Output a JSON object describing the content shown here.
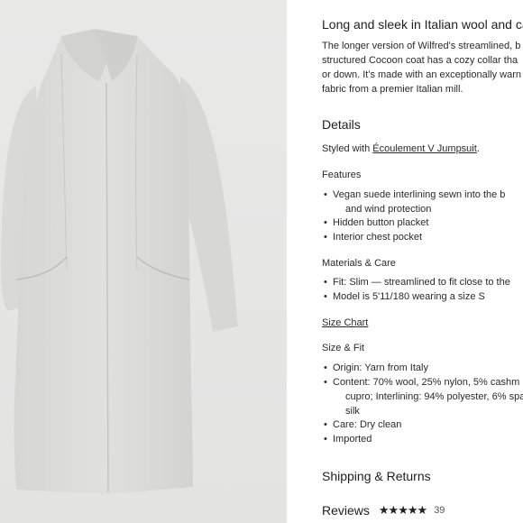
{
  "product": {
    "headline": "Long and sleek in Italian wool and ca",
    "description": [
      "The longer version of Wilfred's streamlined, b",
      "structured Cocoon coat has a cozy collar tha",
      "or down. It's made with an exceptionally warn",
      "fabric from a premier Italian mill."
    ]
  },
  "details": {
    "heading": "Details",
    "styled_with_prefix": "Styled with ",
    "styled_with_link": "Écoulement V Jumpsuit",
    "styled_with_suffix": ".",
    "features_label": "Features",
    "features": [
      "Vegan suede interlining sewn into the b",
      "and wind protection",
      "Hidden button placket",
      "Interior chest pocket"
    ],
    "materials_label": "Materials & Care",
    "materials": [
      "Fit: Slim — streamlined to fit close to the",
      "Model is 5'11/180 wearing a size S"
    ],
    "size_chart_link": "Size Chart",
    "size_fit_label": "Size & Fit",
    "size_fit": [
      "Origin: Yarn from Italy",
      "Content: 70% wool, 25% nylon, 5% cashm",
      "cupro; Interlining: 94% polyester, 6% spa",
      "silk",
      "Care: Dry clean",
      "Imported"
    ]
  },
  "shipping": {
    "heading": "Shipping & Returns"
  },
  "reviews": {
    "label": "Reviews",
    "stars": "★★★★★",
    "count": "39",
    "rating": 4.5
  },
  "colors": {
    "background": "#e6e6e5",
    "coat": "#dcdcda",
    "text": "#222222"
  }
}
